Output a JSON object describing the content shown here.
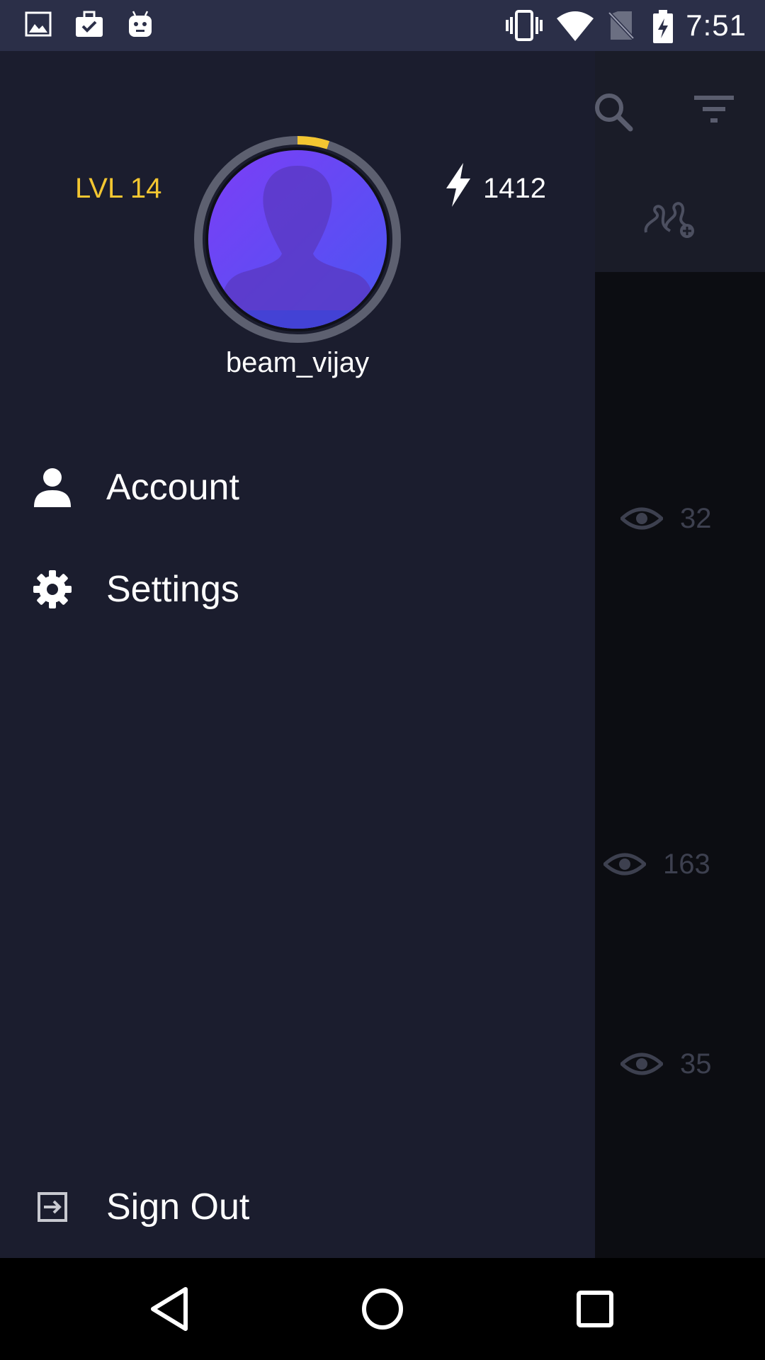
{
  "status_bar": {
    "time": "7:51",
    "left_icons": [
      "image-icon",
      "briefcase-check-icon",
      "android-icon"
    ],
    "right_icons": [
      "vibrate-icon",
      "wifi-icon",
      "no-sim-icon",
      "battery-charging-icon"
    ]
  },
  "drawer": {
    "level": "LVL 14",
    "energy": "1412",
    "username": "beam_vijay",
    "level_progress": 0.05,
    "menu": [
      {
        "label": "Account",
        "icon": "person-icon"
      },
      {
        "label": "Settings",
        "icon": "gear-icon"
      }
    ],
    "sign_out": {
      "label": "Sign Out",
      "icon": "sign-out-icon"
    }
  },
  "background": {
    "view_counts": [
      "32",
      "163",
      "35"
    ],
    "header_icons": [
      "search-icon",
      "filter-icon",
      "add-people-icon"
    ]
  },
  "nav_bar": {
    "buttons": [
      "back-icon",
      "home-icon",
      "recents-icon"
    ]
  },
  "colors": {
    "drawer_bg": "#1b1d2e",
    "status_bar_bg": "#2b2f48",
    "level_accent": "#f3c631",
    "avatar_gradient_start": "#7c3ef6",
    "avatar_gradient_end": "#4a56f2"
  }
}
